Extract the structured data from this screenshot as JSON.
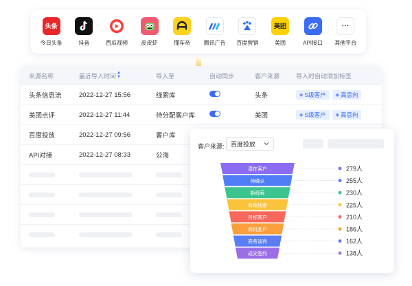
{
  "platforms": [
    {
      "label": "今日头条",
      "icon": "toutiao-icon",
      "badge": "头条",
      "bg": "#e8272b"
    },
    {
      "label": "抖音",
      "icon": "douyin-icon",
      "badge": "",
      "bg": "#111111"
    },
    {
      "label": "西瓜视频",
      "icon": "xigua-video-icon",
      "badge": "",
      "bg": "#ffffff"
    },
    {
      "label": "皮皮虾",
      "icon": "pipixia-icon",
      "badge": "",
      "bg": "#f25a72"
    },
    {
      "label": "懂车帝",
      "icon": "dongchedi-icon",
      "badge": "",
      "bg": "#ffd21e"
    },
    {
      "label": "腾讯广告",
      "icon": "tencent-ads-icon",
      "badge": "",
      "bg": "#ffffff"
    },
    {
      "label": "百度营销",
      "icon": "baidu-marketing-icon",
      "badge": "",
      "bg": "#ffffff"
    },
    {
      "label": "美团",
      "icon": "meituan-icon",
      "badge": "美团",
      "bg": "#ffd100"
    },
    {
      "label": "API接口",
      "icon": "api-link-icon",
      "badge": "",
      "bg": "#3b6cf6"
    },
    {
      "label": "其他平台",
      "icon": "more-dots-icon",
      "badge": "···",
      "bg": "#ffffff"
    }
  ],
  "table": {
    "headers": [
      "来源名称",
      "最近导入时间",
      "导入至",
      "自动同步",
      "客户来源",
      "导入时自动添加标签"
    ],
    "rows": [
      {
        "name": "头条信息流",
        "time": "2022-12-27 15:56",
        "target": "线索库",
        "sync": true,
        "source": "头条",
        "tags": [
          "S级客户",
          "高意向"
        ]
      },
      {
        "name": "美团点评",
        "time": "2022-12-27 11:44",
        "target": "待分配客户库",
        "sync": true,
        "source": "美团",
        "tags": [
          "S级客户",
          "高意向"
        ]
      },
      {
        "name": "百度投放",
        "time": "2022-12-27 09:56",
        "target": "客户库",
        "sync": false,
        "source": "",
        "tags": []
      },
      {
        "name": "API对接",
        "time": "2022-12-27 08:33",
        "target": "公海",
        "sync": false,
        "source": "",
        "tags": []
      }
    ]
  },
  "funnel": {
    "filter_label": "客户来源:",
    "filter_value": "百度投放",
    "stages": [
      {
        "name": "潜在客户",
        "value": "279人",
        "color": "#8b6cf2"
      },
      {
        "name": "待确认",
        "value": "255人",
        "color": "#4f7df5"
      },
      {
        "name": "新线索",
        "value": "230人",
        "color": "#3cc48f"
      },
      {
        "name": "有效线索",
        "value": "225人",
        "color": "#fbc23b"
      },
      {
        "name": "目标客户",
        "value": "210人",
        "color": "#f7675b"
      },
      {
        "name": "商机客户",
        "value": "186人",
        "color": "#fb9f3c"
      },
      {
        "name": "商务谈判",
        "value": "162人",
        "color": "#5b7ef2"
      },
      {
        "name": "成交签约",
        "value": "138人",
        "color": "#9b6ee6"
      }
    ]
  },
  "colors": {
    "accent": "#3b6cf6",
    "arrow": "#f9c046"
  }
}
